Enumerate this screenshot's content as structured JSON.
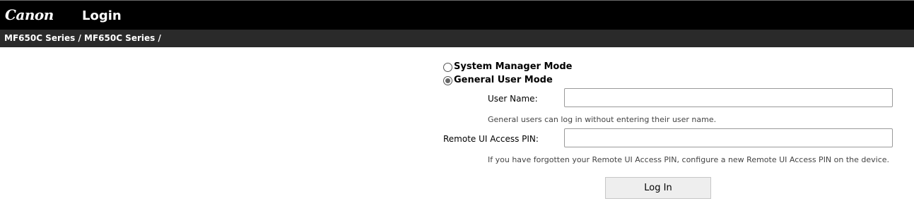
{
  "header": {
    "logo_text": "Canon",
    "page_title": "Login",
    "breadcrumb": "MF650C Series / MF650C Series /"
  },
  "login": {
    "modes": [
      {
        "label": "System Manager Mode",
        "selected": false
      },
      {
        "label": "General User Mode",
        "selected": true
      }
    ],
    "user_name": {
      "label": "User Name:",
      "value": "",
      "hint": "General users can log in without entering their user name."
    },
    "pin": {
      "label": "Remote UI Access PIN:",
      "value": "",
      "hint": "If you have forgotten your Remote UI Access PIN, configure a new Remote UI Access PIN on the device."
    },
    "login_button": "Log In"
  },
  "colors": {
    "header_bg": "#000000",
    "subheader_bg": "#2a2a2a",
    "button_bg": "#eeeeee"
  }
}
